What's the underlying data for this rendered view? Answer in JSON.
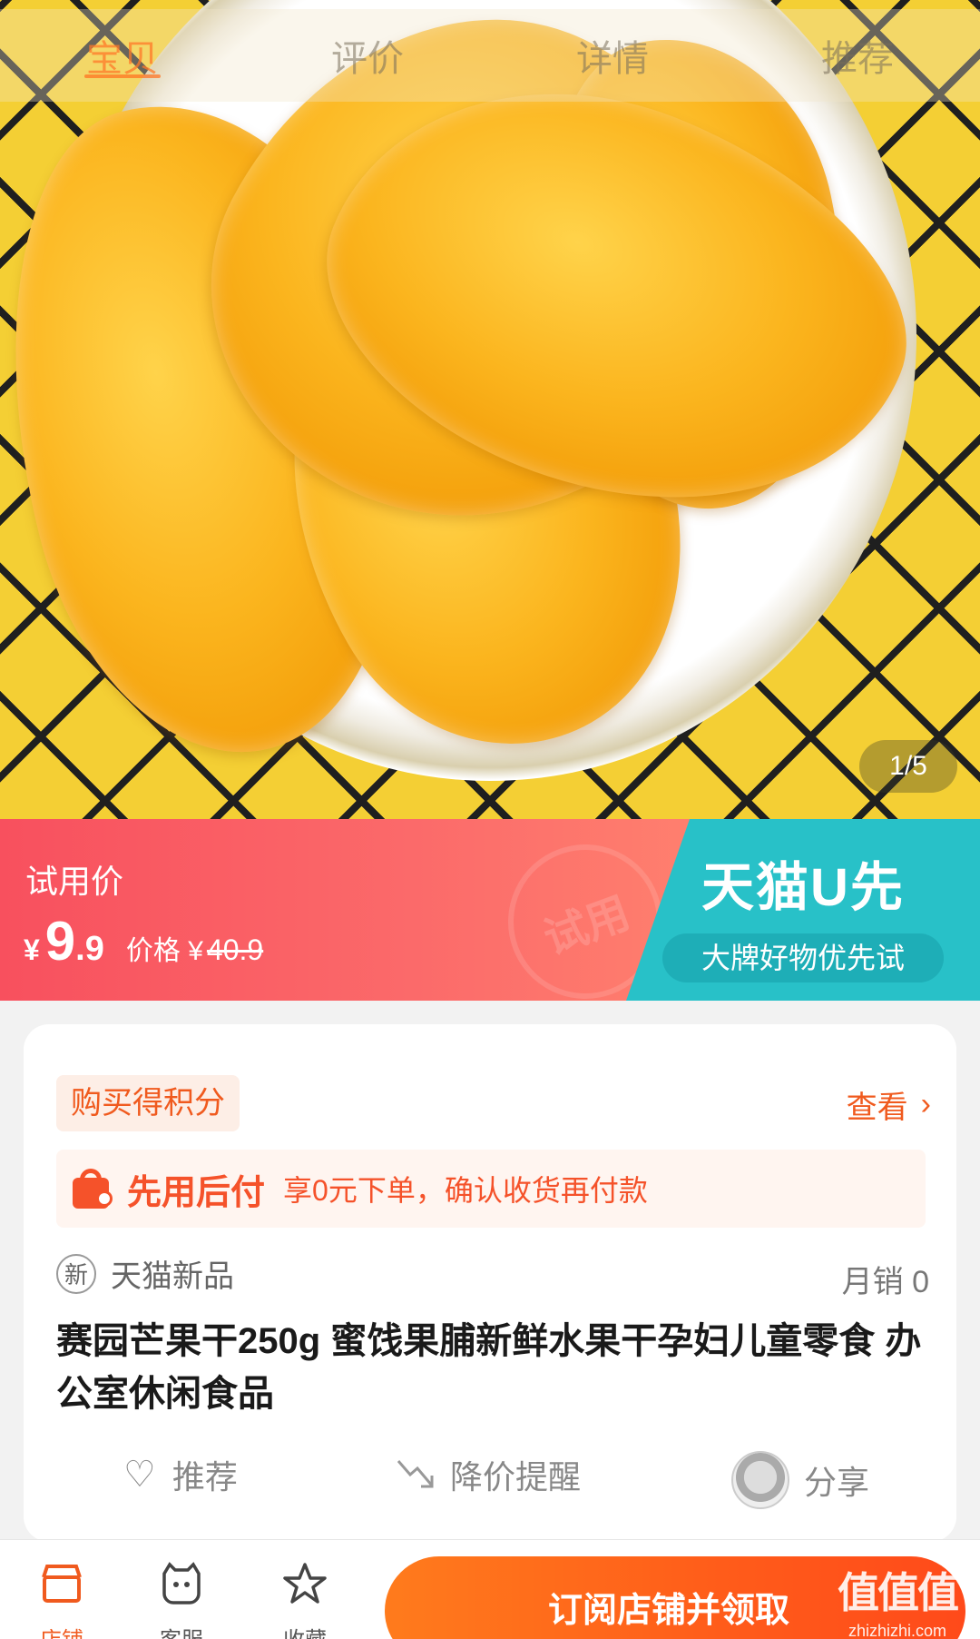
{
  "tabs": [
    {
      "label": "宝贝"
    },
    {
      "label": "评价"
    },
    {
      "label": "详情"
    },
    {
      "label": "推荐"
    }
  ],
  "gallery": {
    "counter": "1/5"
  },
  "price_banner": {
    "label": "试用价",
    "currency": "¥",
    "price_int": "9",
    "price_dec": ".9",
    "orig_label": "价格 ¥",
    "orig_value": "40.9",
    "stamp_text": "试用",
    "brand_main": "天猫U先",
    "brand_sub": "大牌好物优先试"
  },
  "card": {
    "points_label": "购买得积分",
    "view_label": "查看",
    "pay_later_title": "先用后付",
    "pay_later_desc": "享0元下单，确认收货再付款",
    "new_icon_text": "新",
    "new_label": "天猫新品",
    "monthly_sales": "月销 0",
    "title": "赛园芒果干250g 蜜饯果脯新鲜水果干孕妇儿童零食 办公室休闲食品",
    "actions": {
      "recommend": "推荐",
      "price_alert": "降价提醒",
      "share": "分享"
    }
  },
  "bottom_bar": {
    "shop": "店铺",
    "service": "客服",
    "favorite": "收藏",
    "subscribe": "订阅店铺并领取"
  },
  "watermark": {
    "main": "值值值",
    "sub": "zhizhizhi.com"
  },
  "colors": {
    "accent": "#f05a1e",
    "banner_red": "#f8505e",
    "banner_teal": "#28c1c8"
  }
}
